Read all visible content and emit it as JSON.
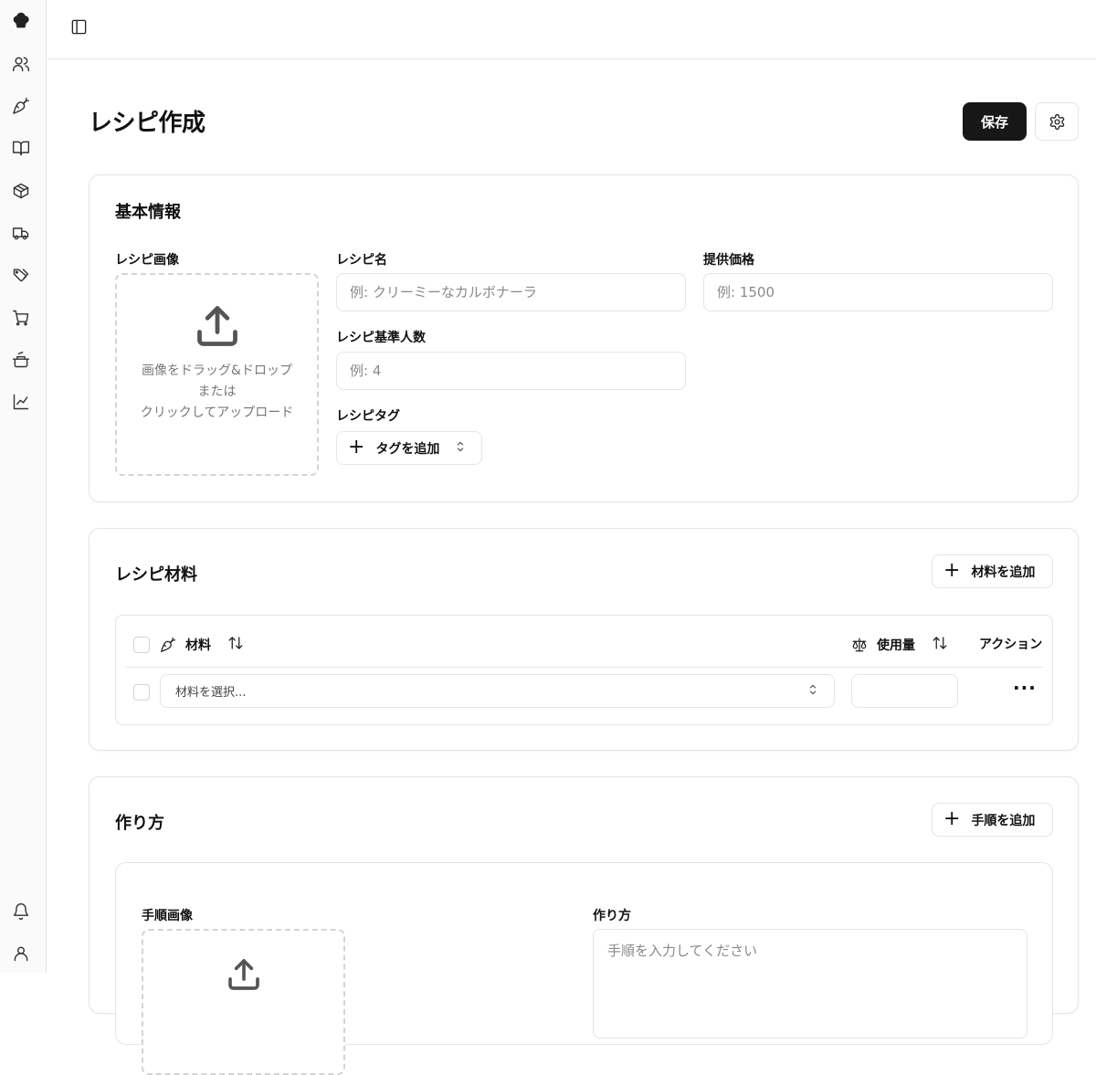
{
  "rail": {
    "items": [
      {
        "icon": "chef-hat-icon"
      },
      {
        "icon": "users-icon"
      },
      {
        "icon": "carrot-icon"
      },
      {
        "icon": "book-open-icon"
      },
      {
        "icon": "package-icon"
      },
      {
        "icon": "truck-icon"
      },
      {
        "icon": "tags-icon"
      },
      {
        "icon": "shopping-cart-icon"
      },
      {
        "icon": "cooking-pot-icon"
      },
      {
        "icon": "chart-line-icon"
      }
    ],
    "bottom": [
      {
        "icon": "bell-icon"
      },
      {
        "icon": "user-icon"
      }
    ]
  },
  "header": {
    "page_title": "レシピ作成",
    "save_label": "保存"
  },
  "basic_info": {
    "title": "基本情報",
    "image_label": "レシピ画像",
    "dropzone_line1": "画像をドラッグ&ドロップ",
    "dropzone_line2": "または",
    "dropzone_line3": "クリックしてアップロード",
    "name_label": "レシピ名",
    "name_placeholder": "例: クリーミーなカルボナーラ",
    "price_label": "提供価格",
    "price_placeholder": "例: 1500",
    "servings_label": "レシピ基準人数",
    "servings_placeholder": "例: 4",
    "tags_label": "レシピタグ",
    "add_tag_label": "タグを追加"
  },
  "ingredients": {
    "title": "レシピ材料",
    "add_label": "材料を追加",
    "columns": {
      "ingredient": "材料",
      "amount": "使用量",
      "actions": "アクション"
    },
    "rows": [
      {
        "select_placeholder": "材料を選択...",
        "amount": "",
        "actions": "···"
      }
    ]
  },
  "method": {
    "title": "作り方",
    "add_label": "手順を追加",
    "step_image_label": "手順画像",
    "step_text_label": "作り方",
    "step_text_placeholder": "手順を入力してください"
  }
}
